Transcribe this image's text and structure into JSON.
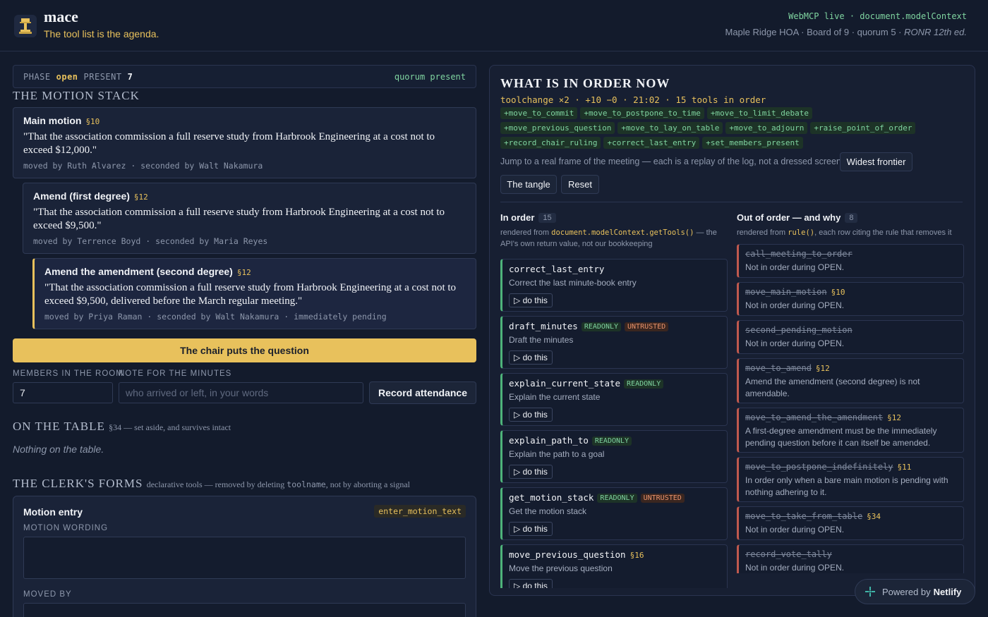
{
  "header": {
    "app_name": "mace",
    "tagline": "The tool list is the agenda.",
    "status_line": "WebMCP live · document.modelContext",
    "context_line": "Maple Ridge HOA · Board of 9 · quorum 5 · ",
    "context_italic": "RONR 12th ed."
  },
  "phase_bar": {
    "phase_label": "PHASE",
    "phase_value": "open",
    "present_label": "PRESENT",
    "present_value": "7",
    "quorum_status": "quorum present"
  },
  "motion_stack": {
    "heading": "THE MOTION STACK",
    "motions": [
      {
        "title": "Main motion",
        "section": "§10",
        "text": "\"That the association commission a full reserve study from Harbrook Engineering at a cost not to exceed $12,000.\"",
        "moved_by": "moved by Ruth Alvarez · seconded by Walt Nakamura"
      },
      {
        "title": "Amend (first degree)",
        "section": "§12",
        "text": "\"That the association commission a full reserve study from Harbrook Engineering at a cost not to exceed $9,500.\"",
        "moved_by": "moved by Terrence Boyd · seconded by Maria Reyes"
      },
      {
        "title": "Amend the amendment (second degree)",
        "section": "§12",
        "text": "\"That the association commission a full reserve study from Harbrook Engineering at a cost not to exceed $9,500, delivered before the March regular meeting.\"",
        "moved_by": "moved by Priya Raman · seconded by Walt Nakamura · immediately pending"
      }
    ],
    "put_question_label": "The chair puts the question"
  },
  "attendance": {
    "members_label": "MEMBERS IN THE ROOM",
    "members_value": "7",
    "note_label": "NOTE FOR THE MINUTES",
    "note_placeholder": "who arrived or left, in your words",
    "record_label": "Record attendance"
  },
  "table_section": {
    "heading": "ON THE TABLE",
    "subtitle": "§34 — set aside, and survives intact",
    "empty_text": "Nothing on the table."
  },
  "clerk_forms": {
    "heading": "THE CLERK'S FORMS",
    "subtitle_pre": "declarative tools — removed by deleting ",
    "subtitle_code": "toolname",
    "subtitle_post": ", not by aborting a signal",
    "form_title": "Motion entry",
    "form_tool": "enter_motion_text",
    "wording_label": "MOTION WORDING",
    "moved_by_label": "MOVED BY"
  },
  "order_panel": {
    "heading": "WHAT IS IN ORDER NOW",
    "summary": "toolchange ×2 · +10 −0 · 21:02 · 15 tools in order",
    "added_tools": [
      "+move_to_commit",
      "+move_to_postpone_to_time",
      "+move_to_limit_debate",
      "+move_previous_question",
      "+move_to_lay_on_table",
      "+move_to_adjourn",
      "+raise_point_of_order",
      "+record_chair_ruling",
      "+correct_last_entry",
      "+set_members_present"
    ],
    "jump_text": "Jump to a real frame of the meeting — each is a replay of the log, not a dressed screen:",
    "jump_buttons": [
      "Widest frontier",
      "The tangle",
      "Reset"
    ]
  },
  "in_order": {
    "heading": "In order",
    "count": "15",
    "sub_pre": "rendered from ",
    "sub_code": "document.modelContext.getTools()",
    "sub_post": " — the API's own return value, not our bookkeeping",
    "do_label": "▷ do this",
    "tools": [
      {
        "name": "correct_last_entry",
        "section": "",
        "badges": [],
        "desc": "Correct the last minute-book entry"
      },
      {
        "name": "draft_minutes",
        "section": "",
        "badges": [
          "READONLY",
          "UNTRUSTED"
        ],
        "desc": "Draft the minutes"
      },
      {
        "name": "explain_current_state",
        "section": "",
        "badges": [
          "READONLY"
        ],
        "desc": "Explain the current state"
      },
      {
        "name": "explain_path_to",
        "section": "",
        "badges": [
          "READONLY"
        ],
        "desc": "Explain the path to a goal"
      },
      {
        "name": "get_motion_stack",
        "section": "",
        "badges": [
          "READONLY",
          "UNTRUSTED"
        ],
        "desc": "Get the motion stack"
      },
      {
        "name": "move_previous_question",
        "section": "§16",
        "badges": [],
        "desc": "Move the previous question"
      }
    ]
  },
  "out_of_order": {
    "heading": "Out of order — and why",
    "count": "8",
    "sub_pre": "rendered from ",
    "sub_code": "rule()",
    "sub_post": ", each row citing the rule that removes it",
    "tools": [
      {
        "name": "call_meeting_to_order",
        "section": "",
        "reason": "Not in order during OPEN."
      },
      {
        "name": "move_main_motion",
        "section": "§10",
        "reason": "Not in order during OPEN."
      },
      {
        "name": "second_pending_motion",
        "section": "",
        "reason": "Not in order during OPEN."
      },
      {
        "name": "move_to_amend",
        "section": "§12",
        "reason": "Amend the amendment (second degree) is not amendable."
      },
      {
        "name": "move_to_amend_the_amendment",
        "section": "§12",
        "reason": "A first-degree amendment must be the immediately pending question before it can itself be amended."
      },
      {
        "name": "move_to_postpone_indefinitely",
        "section": "§11",
        "reason": "In order only when a bare main motion is pending with nothing adhering to it."
      },
      {
        "name": "move_to_take_from_table",
        "section": "§34",
        "reason": "Not in order during OPEN."
      },
      {
        "name": "record_vote_tally",
        "section": "",
        "reason": "Not in order during OPEN."
      }
    ]
  },
  "footer": {
    "powered_by": "Powered by",
    "brand": "Netlify"
  },
  "colors": {
    "background": "#131b2c",
    "accent_gold": "#e8c15c",
    "accent_green": "#7fd4a0",
    "out_of_order_red": "#c0594e"
  }
}
